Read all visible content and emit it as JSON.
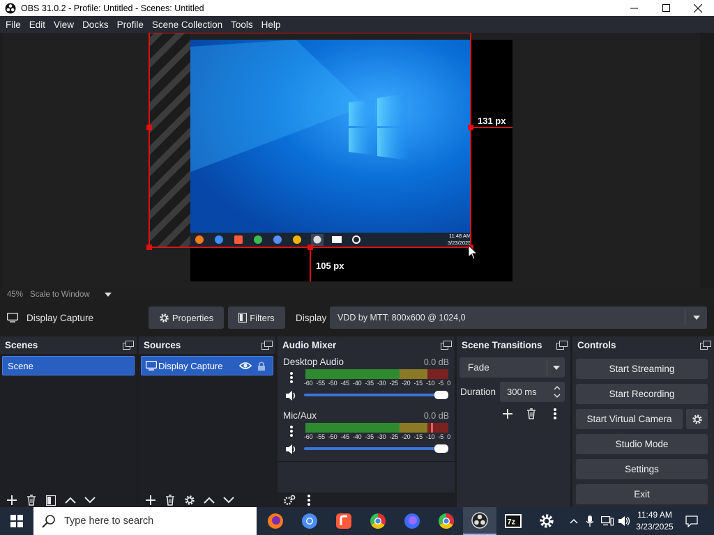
{
  "window": {
    "title": "OBS 31.0.2 - Profile: Untitled - Scenes: Untitled",
    "minimize": "—",
    "maximize": "☐",
    "close": "✕"
  },
  "menu": [
    "File",
    "Edit",
    "View",
    "Docks",
    "Profile",
    "Scene Collection",
    "Tools",
    "Help"
  ],
  "preview": {
    "right_crop_label": "131 px",
    "bottom_crop_label": "105 px",
    "tray_time": "11:48 AM",
    "tray_date": "3/23/2025"
  },
  "zoom": {
    "percent": "45%",
    "mode": "Scale to Window"
  },
  "source_bar": {
    "source_name": "Display Capture",
    "properties_label": "Properties",
    "filters_label": "Filters",
    "display_label": "Display",
    "display_value": "VDD by MTT: 800x600 @ 1024,0"
  },
  "scenes": {
    "title": "Scenes",
    "items": [
      "Scene"
    ]
  },
  "sources": {
    "title": "Sources",
    "items": [
      "Display Capture"
    ]
  },
  "audio_mixer": {
    "title": "Audio Mixer",
    "scale": [
      "-60",
      "-55",
      "-50",
      "-45",
      "-40",
      "-35",
      "-30",
      "-25",
      "-20",
      "-15",
      "-10",
      "-5",
      "0"
    ],
    "channels": [
      {
        "name": "Desktop Audio",
        "db": "0.0 dB",
        "volume": 1.0
      },
      {
        "name": "Mic/Aux",
        "db": "0.0 dB",
        "volume": 1.0
      }
    ]
  },
  "transitions": {
    "title": "Scene Transitions",
    "selected": "Fade",
    "duration_label": "Duration",
    "duration_value": "300 ms"
  },
  "controls": {
    "title": "Controls",
    "start_streaming": "Start Streaming",
    "start_recording": "Start Recording",
    "start_virtual_camera": "Start Virtual Camera",
    "studio_mode": "Studio Mode",
    "settings": "Settings",
    "exit": "Exit"
  },
  "taskbar": {
    "search_placeholder": "Type here to search",
    "time": "11:49 AM",
    "date": "3/23/2025"
  },
  "colors": {
    "accent": "#2a5fc2",
    "panel": "#272a33",
    "crop_red": "#e01010"
  }
}
